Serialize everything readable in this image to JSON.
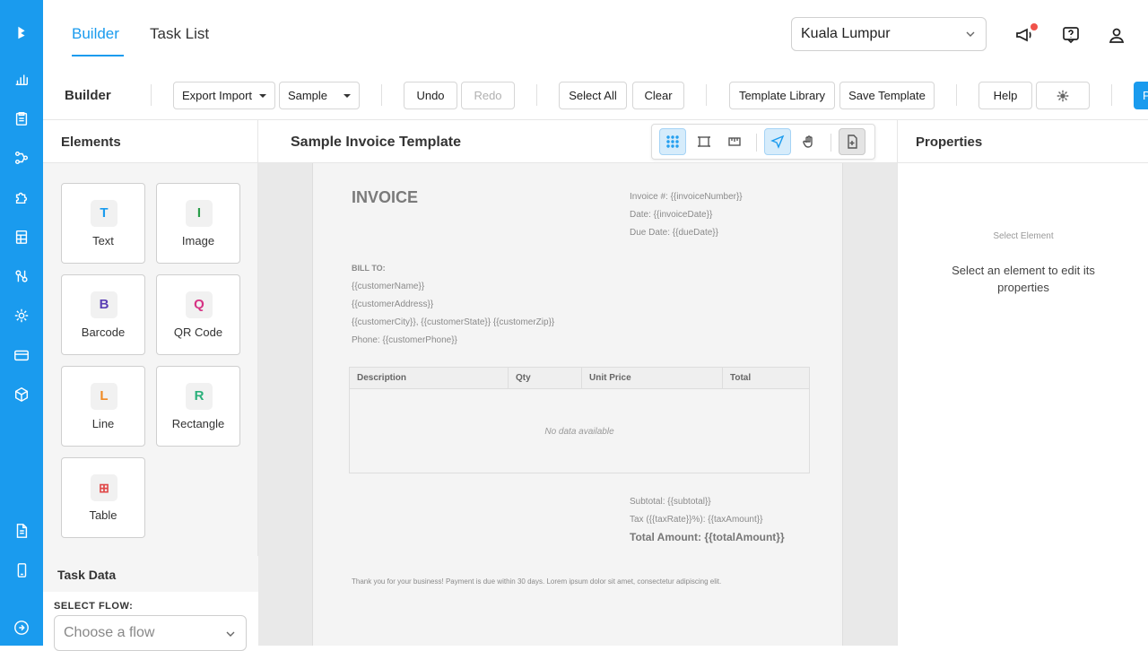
{
  "topbar": {
    "tabs": [
      {
        "label": "Builder",
        "active": true
      },
      {
        "label": "Task List",
        "active": false
      }
    ],
    "location": "Kuala Lumpur"
  },
  "toolbar": {
    "title": "Builder",
    "export_import": "Export Import",
    "sample": "Sample",
    "undo": "Undo",
    "redo": "Redo",
    "select_all": "Select All",
    "clear": "Clear",
    "template_library": "Template Library",
    "save_template": "Save Template",
    "help": "Help",
    "primary_partial": "P"
  },
  "elements": {
    "title": "Elements",
    "items": [
      {
        "icon": "T",
        "label": "Text",
        "color": "#1a9bee"
      },
      {
        "icon": "I",
        "label": "Image",
        "color": "#2a9d4a"
      },
      {
        "icon": "B",
        "label": "Barcode",
        "color": "#5b3fb5"
      },
      {
        "icon": "Q",
        "label": "QR Code",
        "color": "#d63384"
      },
      {
        "icon": "L",
        "label": "Line",
        "color": "#f08a24"
      },
      {
        "icon": "R",
        "label": "Rectangle",
        "color": "#2ab07a"
      },
      {
        "icon": "⊞",
        "label": "Table",
        "color": "#e04848"
      }
    ]
  },
  "task_data": {
    "title": "Task Data",
    "select_flow_label": "SELECT FLOW:",
    "flow_placeholder": "Choose a flow"
  },
  "canvas": {
    "title": "Sample Invoice Template",
    "invoice": {
      "title": "INVOICE",
      "meta": [
        "Invoice #: {{invoiceNumber}}",
        "Date: {{invoiceDate}}",
        "Due Date: {{dueDate}}"
      ],
      "bill_to_label": "BILL TO:",
      "bill_to": [
        "{{customerName}}",
        "{{customerAddress}}",
        "{{customerCity}}, {{customerState}} {{customerZip}}",
        "Phone: {{customerPhone}}"
      ],
      "table_headers": [
        "Description",
        "Qty",
        "Unit Price",
        "Total"
      ],
      "table_empty": "No data available",
      "subtotal": "Subtotal: {{subtotal}}",
      "tax": "Tax ({{taxRate}}%): {{taxAmount}}",
      "total": "Total Amount: {{totalAmount}}",
      "footer": "Thank you for your business! Payment is due within 30 days. Lorem ipsum dolor sit amet, consectetur adipiscing elit."
    }
  },
  "properties": {
    "title": "Properties",
    "select_small": "Select Element",
    "select_msg": "Select an element to edit its properties"
  },
  "colors": {
    "accent": "#1a9bee",
    "notification": "#f0524a"
  }
}
